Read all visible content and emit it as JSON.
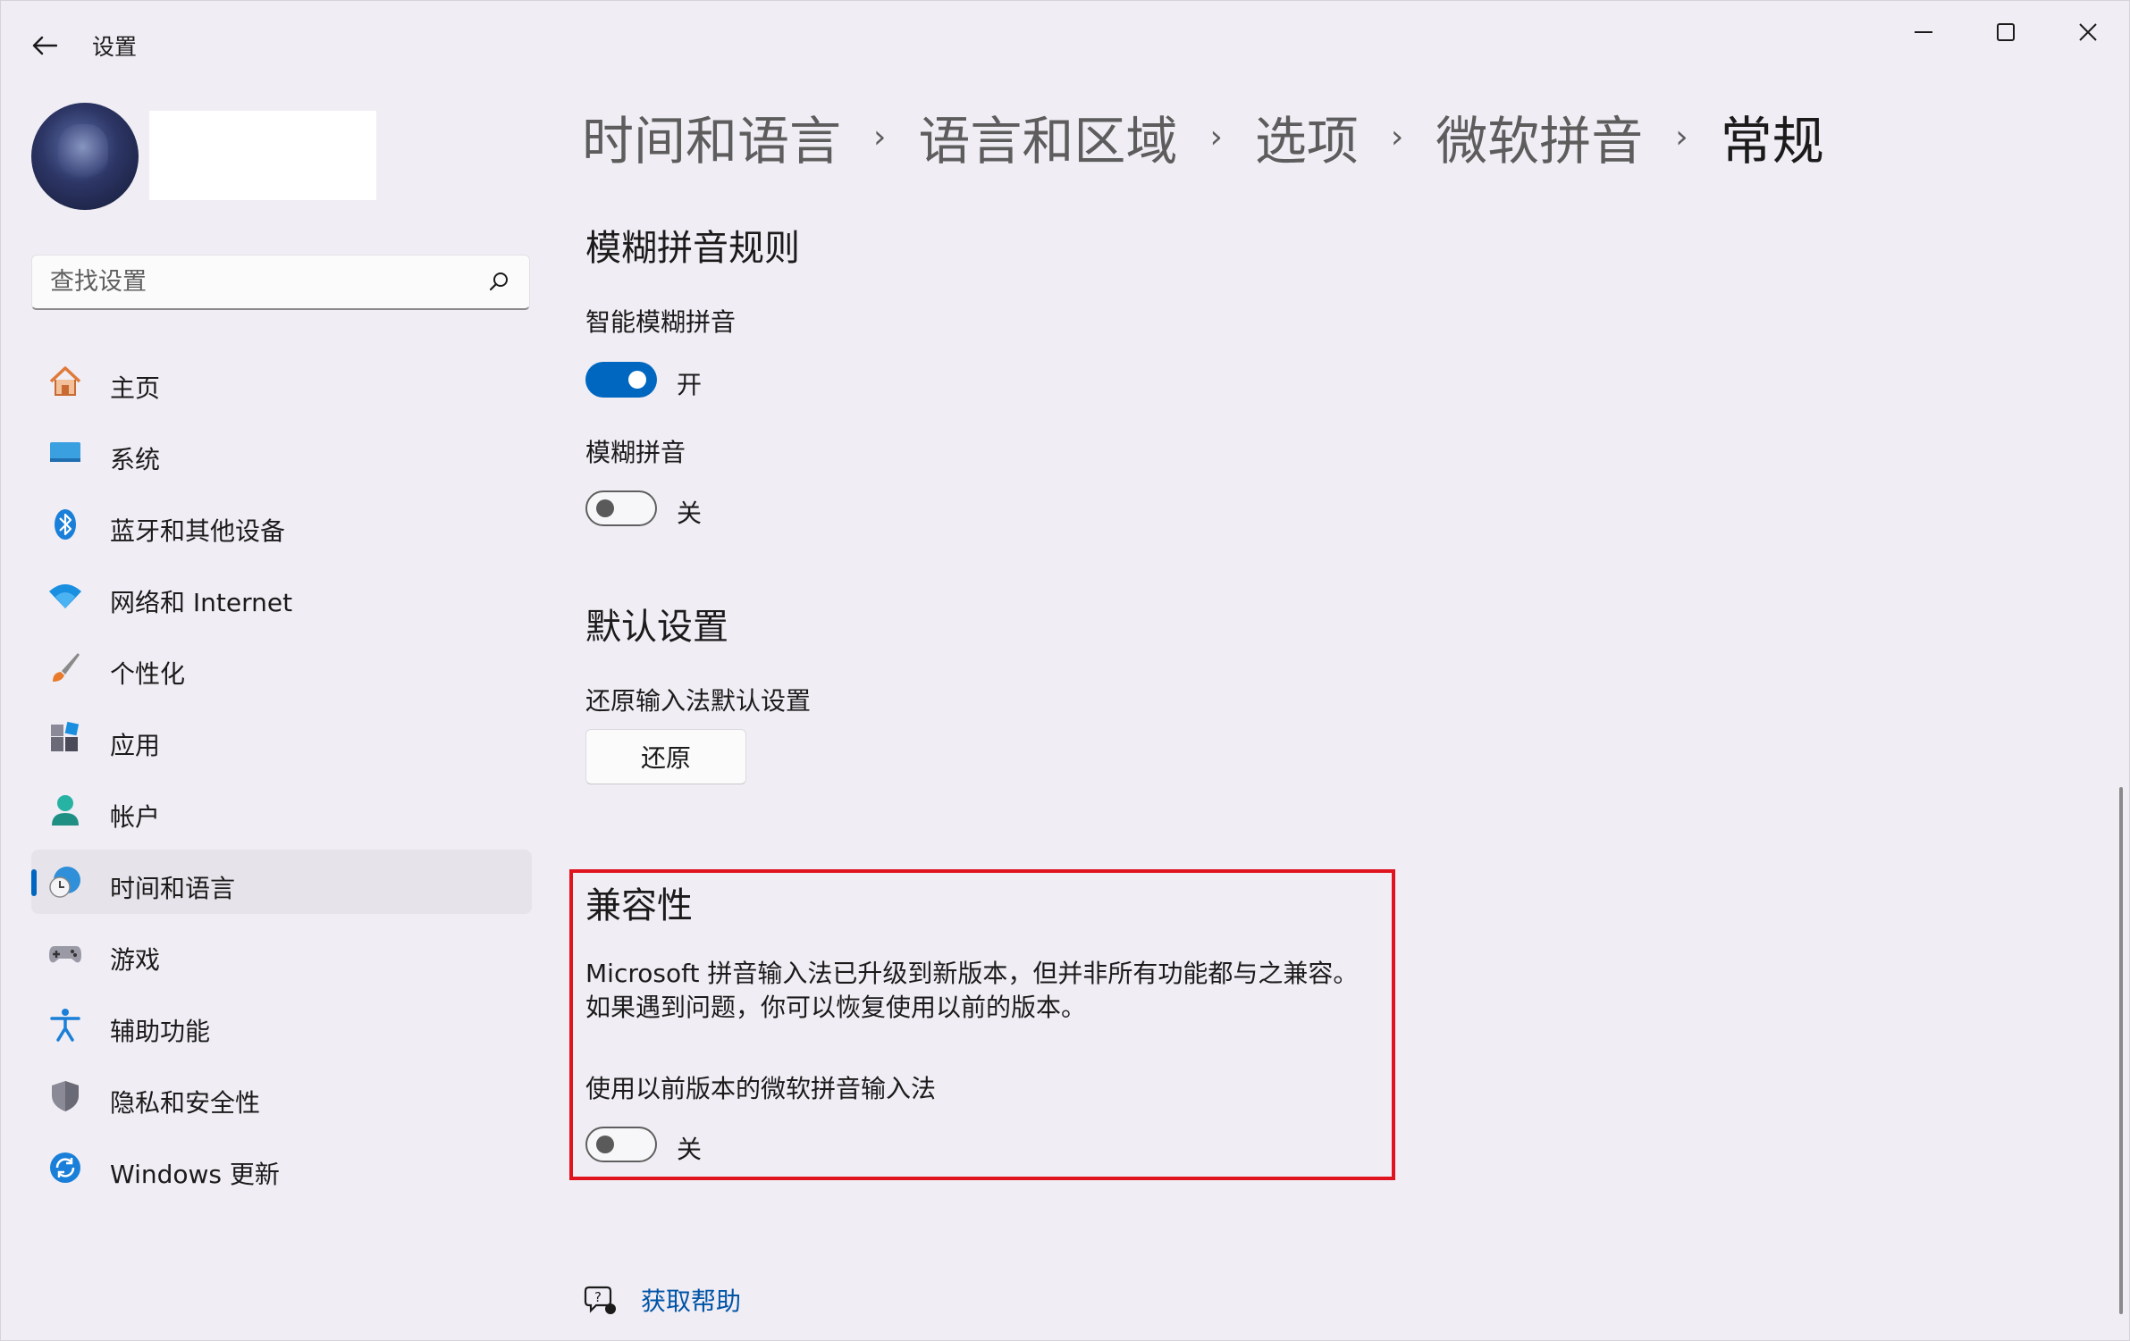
{
  "window": {
    "title": "设置",
    "controls": {
      "minimize": "minimize",
      "maximize": "maximize",
      "close": "close"
    }
  },
  "sidebar": {
    "search_placeholder": "查找设置",
    "items": [
      {
        "label": "主页",
        "icon": "home-icon",
        "active": false
      },
      {
        "label": "系统",
        "icon": "system-icon",
        "active": false
      },
      {
        "label": "蓝牙和其他设备",
        "icon": "bluetooth-icon",
        "active": false
      },
      {
        "label": "网络和 Internet",
        "icon": "wifi-icon",
        "active": false
      },
      {
        "label": "个性化",
        "icon": "brush-icon",
        "active": false
      },
      {
        "label": "应用",
        "icon": "apps-icon",
        "active": false
      },
      {
        "label": "帐户",
        "icon": "account-icon",
        "active": false
      },
      {
        "label": "时间和语言",
        "icon": "time-language-icon",
        "active": true
      },
      {
        "label": "游戏",
        "icon": "gamepad-icon",
        "active": false
      },
      {
        "label": "辅助功能",
        "icon": "accessibility-icon",
        "active": false
      },
      {
        "label": "隐私和安全性",
        "icon": "shield-icon",
        "active": false
      },
      {
        "label": "Windows 更新",
        "icon": "windows-update-icon",
        "active": false
      }
    ]
  },
  "breadcrumb": [
    "时间和语言",
    "语言和区域",
    "选项",
    "微软拼音",
    "常规"
  ],
  "breadcrumb_sep": "›",
  "fuzzy": {
    "title": "模糊拼音规则",
    "smart_label": "智能模糊拼音",
    "smart_state": "开",
    "fuzzy_label": "模糊拼音",
    "fuzzy_state": "关"
  },
  "defaults": {
    "title": "默认设置",
    "restore_label": "还原输入法默认设置",
    "restore_button": "还原"
  },
  "compat": {
    "title": "兼容性",
    "description": "Microsoft 拼音输入法已升级到新版本，但并非所有功能都与之兼容。如果遇到问题，你可以恢复使用以前的版本。",
    "legacy_label": "使用以前版本的微软拼音输入法",
    "legacy_state": "关"
  },
  "help": {
    "label": "获取帮助"
  },
  "colors": {
    "accent": "#0067c0",
    "highlight": "#e0141f",
    "link": "#0054a6"
  }
}
